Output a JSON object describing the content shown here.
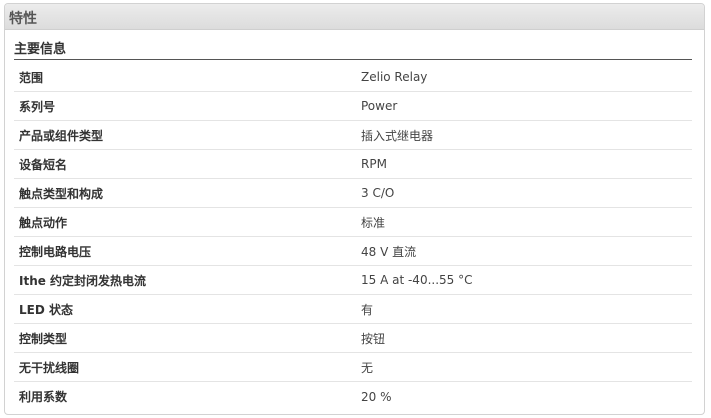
{
  "panel": {
    "title": "特性"
  },
  "section": {
    "title": "主要信息"
  },
  "rows": [
    {
      "label": "范围",
      "value": "Zelio Relay"
    },
    {
      "label": "系列号",
      "value": "Power"
    },
    {
      "label": "产品或组件类型",
      "value": "插入式继电器"
    },
    {
      "label": "设备短名",
      "value": "RPM"
    },
    {
      "label": "触点类型和构成",
      "value": "3 C/O"
    },
    {
      "label": "触点动作",
      "value": "标准"
    },
    {
      "label": "控制电路电压",
      "value": "48 V 直流"
    },
    {
      "label": "Ithe 约定封闭发热电流",
      "value": "15 A at -40...55 °C"
    },
    {
      "label": "LED 状态",
      "value": "有"
    },
    {
      "label": "控制类型",
      "value": "按钮"
    },
    {
      "label": "无干扰线圈",
      "value": "无"
    },
    {
      "label": "利用系数",
      "value": "20 %"
    }
  ]
}
